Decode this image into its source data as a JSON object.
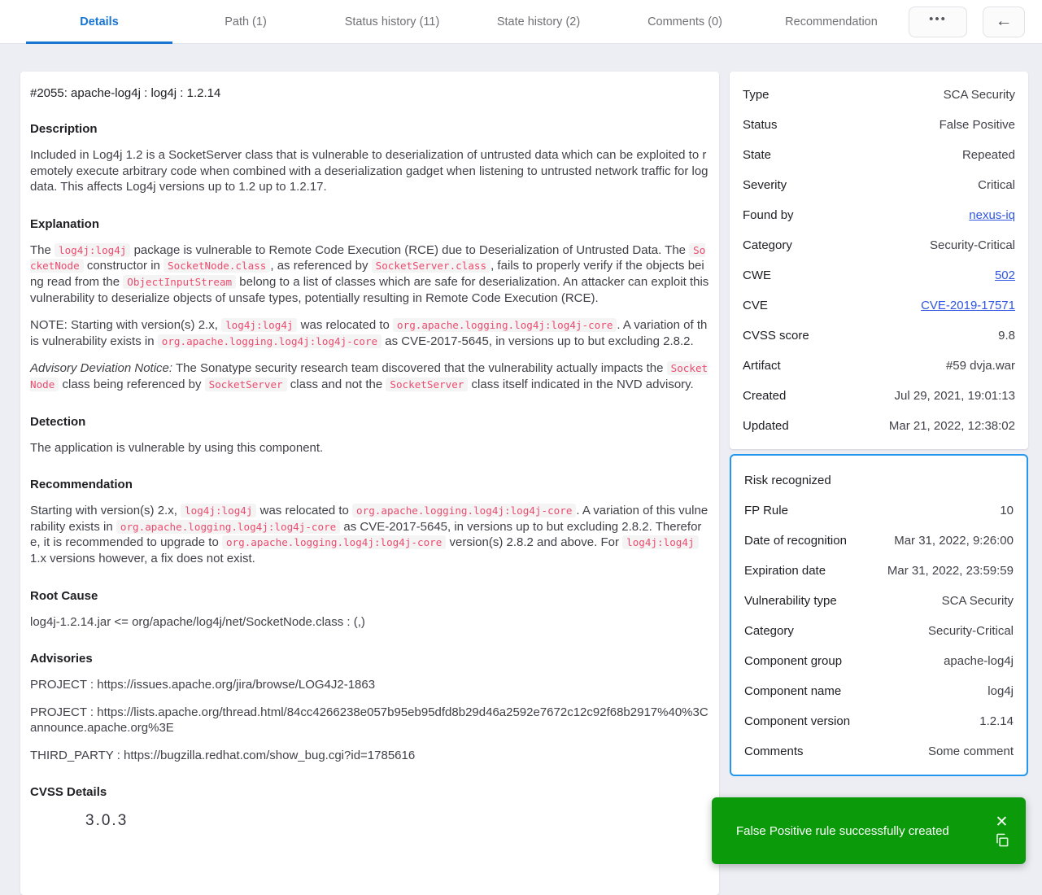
{
  "header": {
    "tabs": [
      {
        "label": "Details",
        "active": true
      },
      {
        "label": "Path (1)"
      },
      {
        "label": "Status history (11)"
      },
      {
        "label": "State history (2)"
      },
      {
        "label": "Comments (0)"
      },
      {
        "label": "Recommendation"
      }
    ],
    "more_icon": "•••",
    "back_icon": "←"
  },
  "colors": {
    "accent_blue": "#1875d1",
    "link_blue": "#2f55e0",
    "chip_pink": "#ec4c6e",
    "highlight_border": "#2396ed",
    "toast_green": "#0a9a0a"
  },
  "article": {
    "title": "#2055: apache-log4j : log4j : 1.2.14",
    "sections": [
      {
        "heading": "Description",
        "paragraphs": [
          [
            {
              "t": "Included in Log4j 1.2 is a SocketServer class that is vulnerable to deserialization of untrusted data which can be exploited to remotely execute arbitrary code when combined with a deserialization gadget when listening to untrusted network traffic for log data. This affects Log4j versions up to 1.2 up to 1.2.17."
            }
          ]
        ]
      },
      {
        "heading": "Explanation",
        "paragraphs": [
          [
            {
              "t": "The "
            },
            {
              "c": "log4j:log4j"
            },
            {
              "t": " package is vulnerable to Remote Code Execution (RCE) due to Deserialization of Untrusted Data. The "
            },
            {
              "c": "SocketNode"
            },
            {
              "t": " constructor in "
            },
            {
              "c": "SocketNode.class"
            },
            {
              "t": ", as referenced by "
            },
            {
              "c": "SocketServer.class"
            },
            {
              "t": ", fails to properly verify if the objects being read from the "
            },
            {
              "c": "ObjectInputStream"
            },
            {
              "t": " belong to a list of classes which  are safe for deserialization. An attacker can exploit this vulnerability to deserialize objects of unsafe types, potentially resulting in Remote Code Execution (RCE)."
            }
          ],
          [
            {
              "t": "NOTE: Starting with version(s) 2.x, "
            },
            {
              "c": "log4j:log4j"
            },
            {
              "t": " was relocated to "
            },
            {
              "c": "org.apache.logging.log4j:log4j-core"
            },
            {
              "t": ". A variation of this vulnerability exists in "
            },
            {
              "c": "org.apache.logging.log4j:log4j-core"
            },
            {
              "t": " as CVE-2017-5645, in versions up to but excluding 2.8.2."
            }
          ],
          [
            {
              "i": "Advisory Deviation Notice:"
            },
            {
              "t": " The Sonatype security research team discovered that the vulnerability actually impacts the "
            },
            {
              "c": "SocketNode"
            },
            {
              "t": " class being referenced by "
            },
            {
              "c": "SocketServer"
            },
            {
              "t": " class and not the "
            },
            {
              "c": "SocketServer"
            },
            {
              "t": " class itself indicated in the NVD advisory."
            }
          ]
        ]
      },
      {
        "heading": "Detection",
        "paragraphs": [
          [
            {
              "t": "The application is vulnerable by using this component."
            }
          ]
        ]
      },
      {
        "heading": "Recommendation",
        "paragraphs": [
          [
            {
              "t": "Starting with version(s) 2.x, "
            },
            {
              "c": "log4j:log4j"
            },
            {
              "t": " was relocated to "
            },
            {
              "c": "org.apache.logging.log4j:log4j-core"
            },
            {
              "t": ". A variation of this vulnerability exists in "
            },
            {
              "c": "org.apache.logging.log4j:log4j-core"
            },
            {
              "t": " as CVE-2017-5645, in versions up to but excluding 2.8.2. Therefore,  it is recommended to upgrade to "
            },
            {
              "c": "org.apache.logging.log4j:log4j-core"
            },
            {
              "t": " version(s) 2.8.2 and above. For "
            },
            {
              "c": "log4j:log4j"
            },
            {
              "t": " 1.x versions however, a fix does not exist."
            }
          ]
        ]
      },
      {
        "heading": "Root Cause",
        "paragraphs": [
          [
            {
              "t": "log4j-1.2.14.jar <= org/apache/log4j/net/SocketNode.class : (,)"
            }
          ]
        ]
      },
      {
        "heading": "Advisories",
        "paragraphs": [
          [
            {
              "t": "PROJECT : https://issues.apache.org/jira/browse/LOG4J2-1863"
            }
          ],
          [
            {
              "t": "PROJECT : https://lists.apache.org/thread.html/84cc4266238e057b95eb95dfd8b29d46a2592e7672c12c92f68b2917%40%3Cannounce.apache.org%3E"
            }
          ],
          [
            {
              "t": "THIRD_PARTY : https://bugzilla.redhat.com/show_bug.cgi?id=1785616"
            }
          ]
        ]
      },
      {
        "heading": "CVSS Details",
        "paragraphs": [],
        "clipped_text": "3.0.3"
      }
    ]
  },
  "info_panel": {
    "rows": [
      {
        "label": "Type",
        "value": "SCA Security"
      },
      {
        "label": "Status",
        "value": "False Positive"
      },
      {
        "label": "State",
        "value": "Repeated"
      },
      {
        "label": "Severity",
        "value": "Critical"
      },
      {
        "label": "Found by",
        "value": "nexus-iq",
        "link": true
      },
      {
        "label": "Category",
        "value": "Security-Critical"
      },
      {
        "label": "CWE",
        "value": "502",
        "link": true
      },
      {
        "label": "CVE",
        "value": "CVE-2019-17571",
        "link": true
      },
      {
        "label": "CVSS score",
        "value": "9.8"
      },
      {
        "label": "Artifact",
        "value": "#59 dvja.war"
      },
      {
        "label": "Created",
        "value": "Jul 29, 2021, 19:01:13"
      },
      {
        "label": "Updated",
        "value": "Mar 21, 2022, 12:38:02"
      }
    ]
  },
  "fp_panel": {
    "title": "Risk recognized",
    "rows": [
      {
        "label": "FP Rule",
        "value": "10"
      },
      {
        "label": "Date of recognition",
        "value": "Mar 31, 2022, 9:26:00"
      },
      {
        "label": "Expiration date",
        "value": "Mar 31, 2022, 23:59:59"
      },
      {
        "label": "Vulnerability type",
        "value": "SCA Security"
      },
      {
        "label": "Category",
        "value": "Security-Critical"
      },
      {
        "label": "Component group",
        "value": "apache-log4j"
      },
      {
        "label": "Component name",
        "value": "log4j"
      },
      {
        "label": "Component version",
        "value": "1.2.14"
      },
      {
        "label": "Comments",
        "value": "Some comment"
      }
    ]
  },
  "toast": {
    "message": "False Positive rule successfully created",
    "close_icon": "✕"
  }
}
